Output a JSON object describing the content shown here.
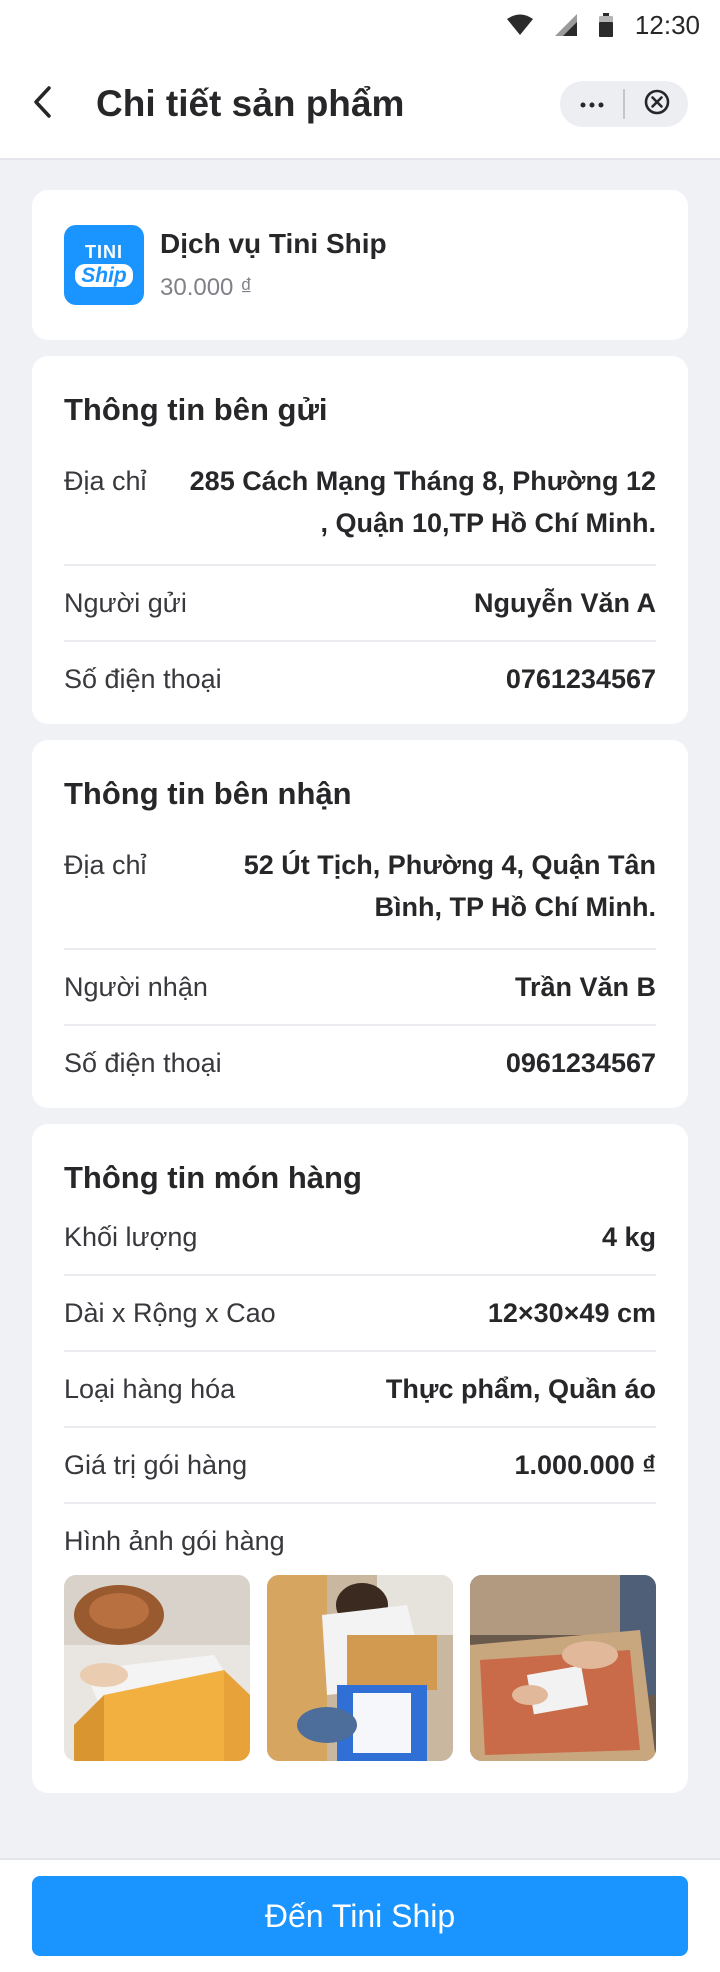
{
  "status_bar": {
    "time": "12:30",
    "icons": [
      "wifi-icon",
      "signal-icon",
      "battery-icon"
    ]
  },
  "header": {
    "title": "Chi tiết sản phẩm",
    "back_icon": "chevron-left-icon",
    "more_icon": "more-icon",
    "close_icon": "close-circle-icon"
  },
  "service": {
    "logo_line1": "TINI",
    "logo_line2": "Ship",
    "name": "Dịch vụ Tini Ship",
    "price": "30.000 ₫"
  },
  "sender": {
    "title": "Thông tin bên gửi",
    "rows": [
      {
        "label": "Địa chỉ",
        "value": "285 Cách Mạng Tháng 8, Phường 12 , Quận 10,TP Hồ Chí Minh."
      },
      {
        "label": "Người gửi",
        "value": "Nguyễn Văn A"
      },
      {
        "label": "Số điện thoại",
        "value": "0761234567"
      }
    ]
  },
  "receiver": {
    "title": "Thông tin bên nhận",
    "rows": [
      {
        "label": "Địa chỉ",
        "value": "52 Út Tịch, Phường 4, Quận Tân Bình, TP Hồ Chí Minh."
      },
      {
        "label": "Người nhận",
        "value": "Trần Văn B"
      },
      {
        "label": "Số điện thoại",
        "value": "0961234567"
      }
    ]
  },
  "package": {
    "title": "Thông tin món hàng",
    "rows": [
      {
        "label": "Khối lượng",
        "value": "4 kg"
      },
      {
        "label": "Dài x Rộng x Cao",
        "value": "12×30×49 cm"
      },
      {
        "label": "Loại hàng hóa",
        "value": "Thực phẩm, Quần áo"
      },
      {
        "label": "Giá trị gói hàng",
        "value": "1.000.000 ₫"
      }
    ],
    "photos_label": "Hình ảnh gói hàng"
  },
  "footer": {
    "button_label": "Đến Tini Ship"
  },
  "colors": {
    "accent": "#1a94ff",
    "background": "#eff1f5",
    "card": "#ffffff",
    "text": "#27272a",
    "muted": "#808089"
  }
}
